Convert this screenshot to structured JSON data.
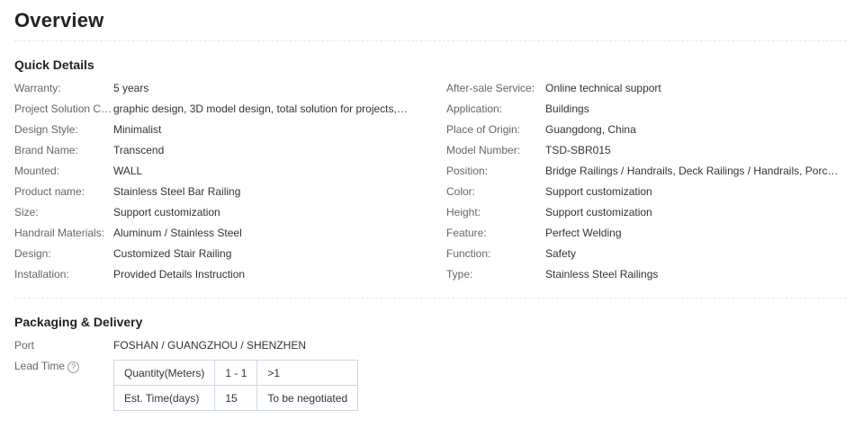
{
  "page": {
    "title": "Overview"
  },
  "quick_details": {
    "title": "Quick Details",
    "left": [
      {
        "label": "Warranty:",
        "value": "5 years"
      },
      {
        "label": "Project Solution Ca...",
        "value": "graphic design, 3D model design, total solution for projects, C..."
      },
      {
        "label": "Design Style:",
        "value": "Minimalist"
      },
      {
        "label": "Brand Name:",
        "value": "Transcend"
      },
      {
        "label": "Mounted:",
        "value": "WALL"
      },
      {
        "label": "Product name:",
        "value": "Stainless Steel Bar Railing"
      },
      {
        "label": "Size:",
        "value": "Support customization"
      },
      {
        "label": "Handrail Materials:",
        "value": "Aluminum / Stainless Steel"
      },
      {
        "label": "Design:",
        "value": "Customized Stair Railing"
      },
      {
        "label": "Installation:",
        "value": "Provided Details Instruction"
      }
    ],
    "right": [
      {
        "label": "After-sale Service:",
        "value": "Online technical support"
      },
      {
        "label": "Application:",
        "value": "Buildings"
      },
      {
        "label": "Place of Origin:",
        "value": "Guangdong, China"
      },
      {
        "label": "Model Number:",
        "value": "TSD-SBR015"
      },
      {
        "label": "Position:",
        "value": "Bridge Railings / Handrails, Deck Railings / Handrails, Porch R..."
      },
      {
        "label": "Color:",
        "value": "Support customization"
      },
      {
        "label": "Height:",
        "value": "Support customization"
      },
      {
        "label": "Feature:",
        "value": "Perfect Welding"
      },
      {
        "label": "Function:",
        "value": "Safety"
      },
      {
        "label": "Type:",
        "value": "Stainless Steel Railings"
      }
    ]
  },
  "packaging": {
    "title": "Packaging & Delivery",
    "port_label": "Port",
    "port_value": "FOSHAN / GUANGZHOU / SHENZHEN",
    "lead_time_label": "Lead Time",
    "help_icon": "question-circle-icon",
    "help_glyph": "?",
    "lead_time_table": [
      [
        "Quantity(Meters)",
        "1 - 1",
        ">1"
      ],
      [
        "Est. Time(days)",
        "15",
        "To be negotiated"
      ]
    ]
  }
}
